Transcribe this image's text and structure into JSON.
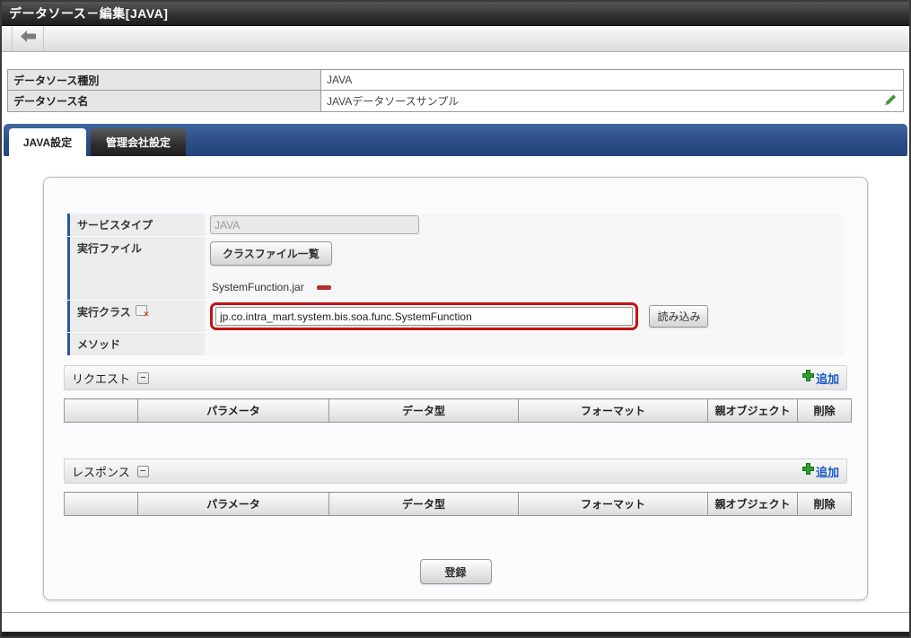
{
  "window": {
    "title": "データソース－編集[JAVA]"
  },
  "toolbar": {
    "back_icon": "arrow-left"
  },
  "info_table": {
    "rows": [
      {
        "label": "データソース種別",
        "value": "JAVA"
      },
      {
        "label": "データソース名",
        "value": "JAVAデータソースサンプル"
      }
    ]
  },
  "tabs": [
    {
      "label": "JAVA設定",
      "active": true
    },
    {
      "label": "管理会社設定",
      "active": false
    }
  ],
  "form": {
    "service_type": {
      "label": "サービスタイプ",
      "value": "JAVA"
    },
    "exec_file": {
      "label": "実行ファイル",
      "button_label": "クラスファイル一覧",
      "file_name": "SystemFunction.jar"
    },
    "exec_class": {
      "label": "実行クラス",
      "value": "jp.co.intra_mart.system.bis.soa.func.SystemFunction",
      "load_button_label": "読み込み"
    },
    "method": {
      "label": "メソッド"
    }
  },
  "request_section": {
    "title": "リクエスト",
    "toggle": "−",
    "add_label": "追加",
    "columns": [
      "",
      "パラメータ",
      "データ型",
      "フォーマット",
      "親オブジェクト",
      "削除"
    ]
  },
  "response_section": {
    "title": "レスポンス",
    "toggle": "−",
    "add_label": "追加",
    "columns": [
      "",
      "パラメータ",
      "データ型",
      "フォーマット",
      "親オブジェクト",
      "削除"
    ]
  },
  "register_button_label": "登録",
  "icons": {
    "back": "arrow-left",
    "edit": "pencil-green",
    "remove_file": "red-minus",
    "clear_input": "box-red-x",
    "add": "green-plus",
    "collapse": "minus-toggle"
  },
  "colors": {
    "tab_bar_blue": "#2c4d86",
    "label_accent_blue": "#2b5797",
    "highlight_red": "#c41212",
    "link_blue": "#1a5dc8",
    "add_green": "#2ca02c",
    "edit_green": "#3a9e3a",
    "remove_red": "#b23232"
  }
}
